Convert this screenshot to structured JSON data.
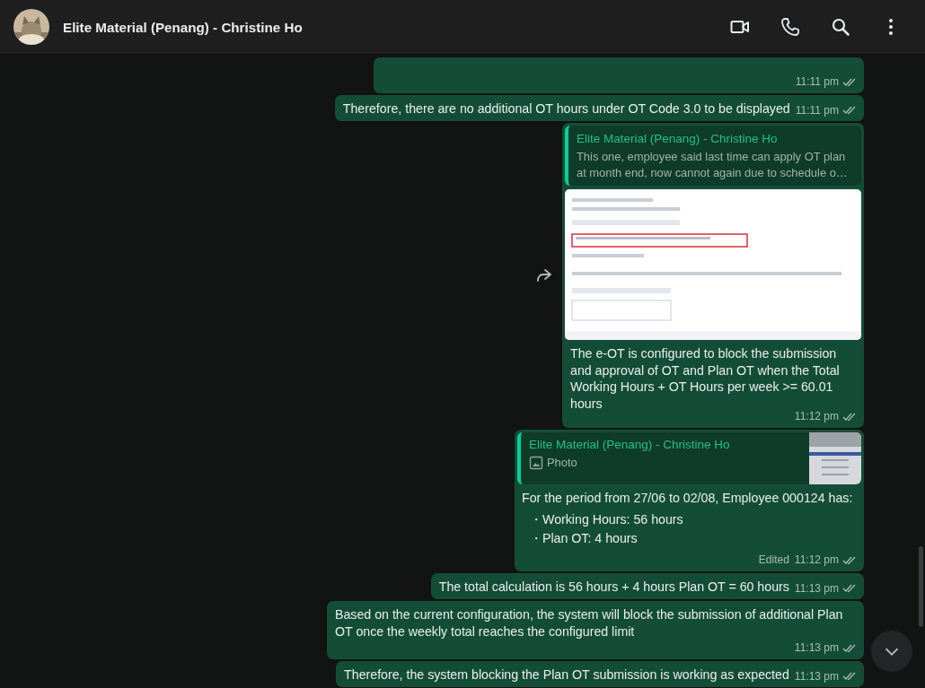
{
  "header": {
    "title": "Elite Material (Penang) - Christine Ho"
  },
  "messages": [
    {
      "kind": "clipped",
      "time": "11:11 pm"
    },
    {
      "kind": "text",
      "text": "Therefore, there are no additional OT hours under OT Code 3.0 to be displayed",
      "time": "11:11 pm"
    },
    {
      "kind": "image_reply",
      "quote_author": "Elite Material (Penang) - Christine Ho",
      "quote_text": "This one, employee said last time can apply OT plan at month end, now cannot again due to schedule o…",
      "text": "The e-OT is configured to block the submission and approval of OT and Plan OT when the Total Working Hours + OT Hours per week >= 60.01 hours",
      "time": "11:12 pm"
    },
    {
      "kind": "photo_reply",
      "quote_author": "Elite Material (Penang) - Christine Ho",
      "quote_text": "Photo",
      "text": "For the period from 27/06 to 02/08, Employee 000124 has:",
      "bullets": [
        "・Working Hours: 56 hours",
        "・Plan OT: 4 hours"
      ],
      "edited": "Edited",
      "time": "11:12 pm"
    },
    {
      "kind": "text",
      "text": "The total calculation is 56 hours + 4 hours Plan OT = 60 hours",
      "time": "11:13 pm"
    },
    {
      "kind": "text",
      "text": "Based on the current configuration, the system will block the submission of additional Plan OT once the weekly total reaches the configured limit",
      "time": "11:13 pm"
    },
    {
      "kind": "text",
      "text": "Therefore, the system blocking the Plan OT submission is working as expected",
      "time": "11:13 pm"
    }
  ]
}
